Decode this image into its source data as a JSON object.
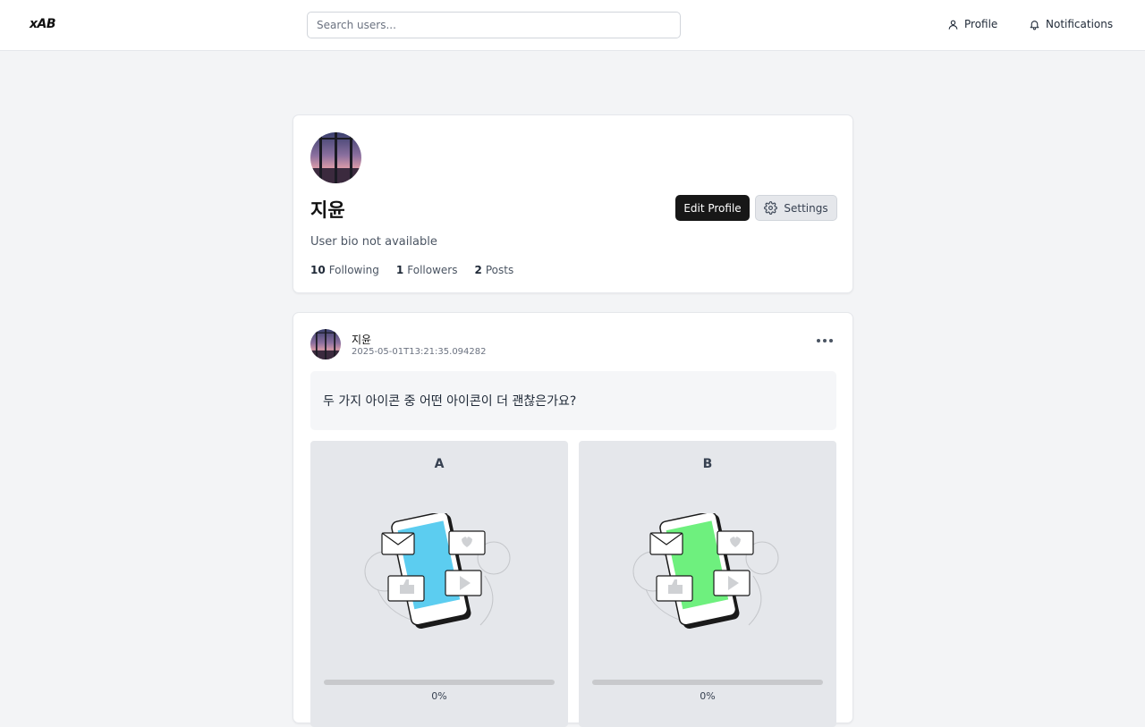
{
  "header": {
    "logo": "xAB",
    "search_placeholder": "Search users...",
    "nav": {
      "profile": "Profile",
      "notifications": "Notifications"
    }
  },
  "profile": {
    "name": "지윤",
    "bio": "User bio not available",
    "edit_label": "Edit Profile",
    "settings_label": "Settings",
    "stats": {
      "following_count": "10",
      "following_label": "Following",
      "followers_count": "1",
      "followers_label": "Followers",
      "posts_count": "2",
      "posts_label": "Posts"
    }
  },
  "post": {
    "author": "지윤",
    "timestamp": "2025-05-01T13:21:35.094282",
    "question": "두 가지 아이콘 중 어떤 아이콘이 더 괜찮은가요?",
    "options": [
      {
        "label": "A",
        "screen_color": "#5ccdf0",
        "vote_fraction": 0,
        "percent_text": "0%"
      },
      {
        "label": "B",
        "screen_color": "#6ef07e",
        "vote_fraction": 0,
        "percent_text": "0%"
      }
    ]
  },
  "colors": {
    "accent": "#171717",
    "page_bg": "#f3f4f6"
  }
}
